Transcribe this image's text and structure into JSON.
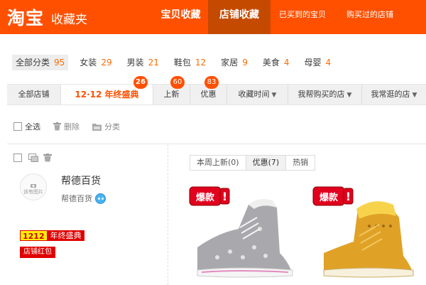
{
  "header": {
    "logo": "淘宝",
    "subtitle": "收藏夹",
    "nav": [
      {
        "label": "宝贝收藏",
        "active": false,
        "size": "big"
      },
      {
        "label": "店铺收藏",
        "active": true,
        "size": "big"
      },
      {
        "label": "已买到的宝贝",
        "active": false,
        "size": "small"
      },
      {
        "label": "购买过的店铺",
        "active": false,
        "size": "small"
      }
    ]
  },
  "categories": [
    {
      "label": "全部分类",
      "count": "95",
      "active": true
    },
    {
      "label": "女装",
      "count": "29"
    },
    {
      "label": "男装",
      "count": "21"
    },
    {
      "label": "鞋包",
      "count": "12"
    },
    {
      "label": "家居",
      "count": "9"
    },
    {
      "label": "美食",
      "count": "4"
    },
    {
      "label": "母婴",
      "count": "4"
    }
  ],
  "filter_tabs": {
    "all_shops": "全部店铺",
    "promo": "12·12 年终盛典",
    "promo_badge": "26",
    "new": "上新",
    "new_badge": "60",
    "sale": "优惠",
    "sale_badge": "83",
    "fav_time": "收藏时间",
    "bought_shops": "我帮购买的店",
    "visited_shops": "我常逛的店"
  },
  "actions": {
    "select_all": "全选",
    "delete": "删除",
    "classify": "分类"
  },
  "shop": {
    "logo_placeholder": "该有图片",
    "name": "帮德百货",
    "sub_name": "帮德百货",
    "promo_tag_1": "1212",
    "promo_tag_2": "年终盛典",
    "red_packet": "店铺红包"
  },
  "product_tabs": [
    {
      "label": "本周上新(0)",
      "active": false
    },
    {
      "label": "优惠(7)",
      "active": true
    },
    {
      "label": "热销",
      "active": false
    }
  ],
  "products": [
    {
      "badge": "爆款",
      "color": "gray"
    },
    {
      "badge": "爆款",
      "color": "yellow"
    }
  ],
  "colors": {
    "brand": "#ff5000",
    "active_nav": "#c44a00",
    "count": "#ff6a00",
    "red": "#e10000"
  }
}
